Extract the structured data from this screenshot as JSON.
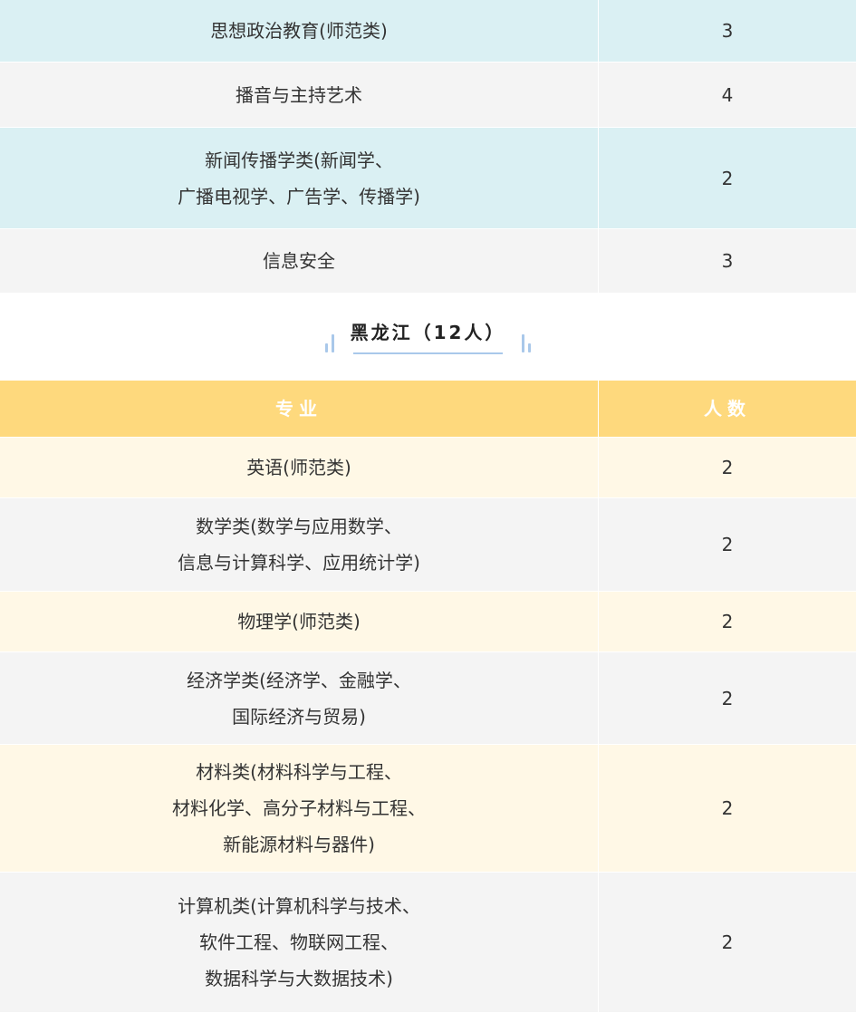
{
  "top_rows": [
    {
      "major": "思想政治教育(师范类)",
      "count": "3"
    },
    {
      "major": "播音与主持艺术",
      "count": "4"
    },
    {
      "major": "新闻传播学类(新闻学、\n广播电视学、广告学、传播学)",
      "count": "2"
    },
    {
      "major": "信息安全",
      "count": "3"
    }
  ],
  "section": {
    "title": "黑龙江（12人）"
  },
  "table": {
    "header_major": "专业",
    "header_count": "人数",
    "rows": [
      {
        "major": "英语(师范类)",
        "count": "2"
      },
      {
        "major": "数学类(数学与应用数学、\n信息与计算科学、应用统计学)",
        "count": "2"
      },
      {
        "major": "物理学(师范类)",
        "count": "2"
      },
      {
        "major": "经济学类(经济学、金融学、\n国际经济与贸易)",
        "count": "2"
      },
      {
        "major": "材料类(材料科学与工程、\n材料化学、高分子材料与工程、\n新能源材料与器件)",
        "count": "2"
      },
      {
        "major": "计算机类(计算机科学与技术、\n软件工程、物联网工程、\n数据科学与大数据技术)",
        "count": "2"
      }
    ]
  },
  "colors": {
    "teal_row": "#daf0f3",
    "gray_row": "#f4f4f4",
    "header_yellow": "#fed97d",
    "light_yellow_row": "#fff8e6",
    "accent_blue": "#a9c8ea"
  }
}
